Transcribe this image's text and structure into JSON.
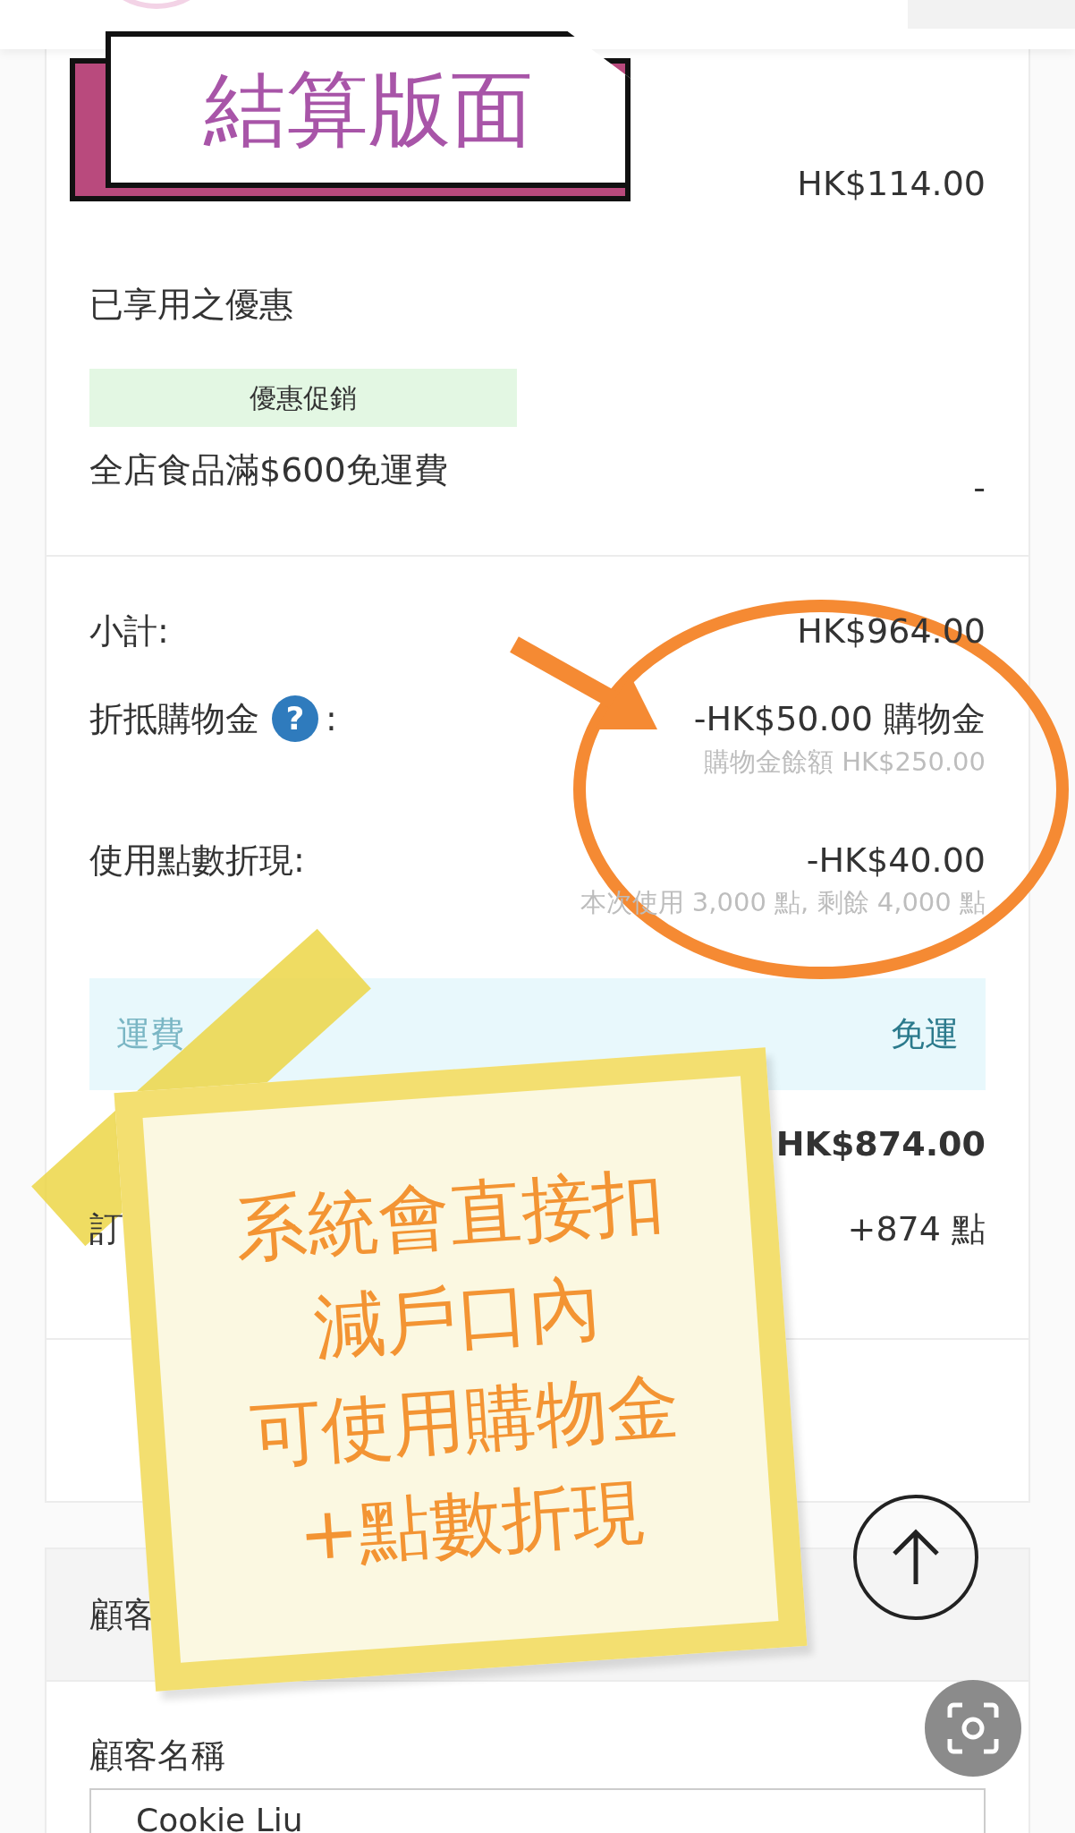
{
  "title_banner": {
    "text": "結算版面"
  },
  "order_item": {
    "amount": "HK$114.00"
  },
  "discounts": {
    "heading": "已享用之優惠",
    "badge": "優惠促銷",
    "promotion": "全店食品滿$600免運費",
    "promotion_value": "-"
  },
  "summary_rows": [
    {
      "kind": "line",
      "label": "小計:",
      "value": "HK$964.00"
    },
    {
      "kind": "line",
      "label": "折抵購物金",
      "help": "?",
      "suffix": ":",
      "value": "-HK$50.00 購物金",
      "note": "購物金餘額 HK$250.00"
    },
    {
      "kind": "line",
      "label": "使用點數折現:",
      "value": "-HK$40.00",
      "note": "本次使用 3,000 點, 剩餘 4,000 點"
    },
    {
      "kind": "band",
      "label": "運費",
      "value": "免運"
    },
    {
      "kind": "total",
      "value": "HK$874.00"
    },
    {
      "kind": "line",
      "label": "訂",
      "value": "+874 點"
    }
  ],
  "customer": {
    "heading": "顧客",
    "name_label": "顧客名稱",
    "name_value": "Cookie Liu"
  },
  "sticky_note": {
    "lines": [
      "系統會直接扣",
      "減戶口內",
      "可使用購物金",
      "+點數折現"
    ]
  }
}
